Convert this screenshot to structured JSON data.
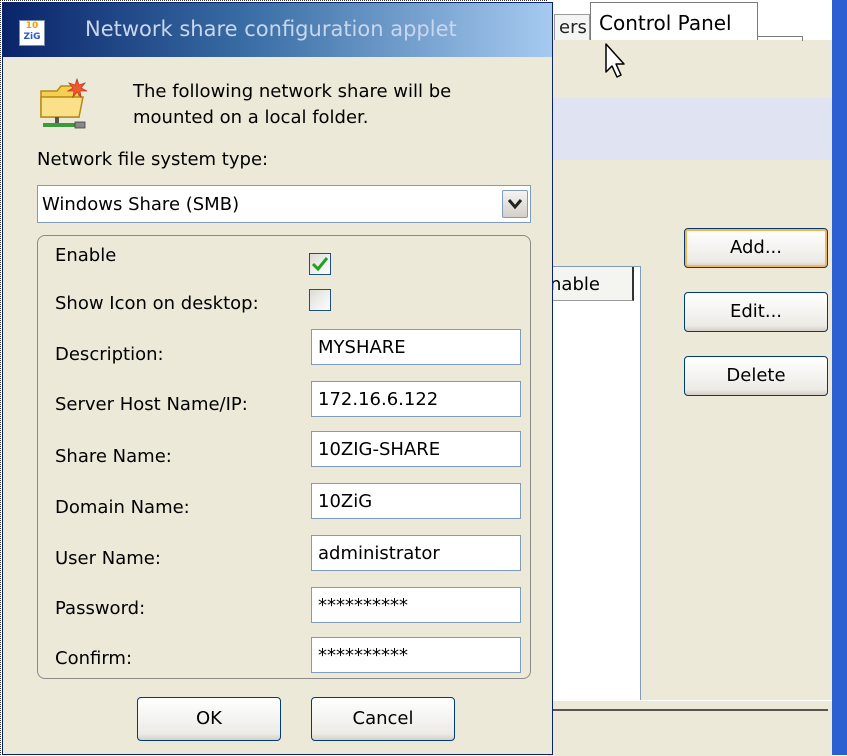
{
  "background_window": {
    "tabs": [
      {
        "label": "ers"
      },
      {
        "label": "Control Panel"
      }
    ],
    "list_column_header": "nable",
    "buttons": {
      "add": "Add...",
      "edit": "Edit...",
      "delete": "Delete"
    }
  },
  "dialog": {
    "title": "Network share configuration applet",
    "title_icon_text_top": "10",
    "title_icon_text_bottom": "ZiG",
    "header_message": "The following network share will be mounted on a local folder.",
    "fs_type_label": "Network file system type:",
    "fs_type_value": "Windows Share (SMB)",
    "fields": {
      "enable": {
        "label": "Enable",
        "checked": true
      },
      "show_icon": {
        "label": "Show Icon on desktop:",
        "checked": false
      },
      "description": {
        "label": "Description:",
        "value": "MYSHARE"
      },
      "server": {
        "label": "Server Host Name/IP:",
        "value": "172.16.6.122"
      },
      "share_name": {
        "label": "Share Name:",
        "value": "10ZIG-SHARE"
      },
      "domain": {
        "label": "Domain Name:",
        "value": "10ZiG"
      },
      "user": {
        "label": "User Name:",
        "value": "administrator"
      },
      "password": {
        "label": "Password:",
        "value": "**********"
      },
      "confirm": {
        "label": "Confirm:",
        "value": "**********"
      }
    },
    "buttons": {
      "ok": "OK",
      "cancel": "Cancel"
    }
  },
  "colors": {
    "title_gradient_start": "#0a246a",
    "title_gradient_end": "#a6caf0",
    "dialog_face": "#ece9d8",
    "checkmark_green": "#21a121",
    "window_edge_blue": "#2c5fd1"
  },
  "icons": [
    "folder-network-icon",
    "checkmark-icon",
    "dropdown-arrow-icon",
    "mouse-cursor-icon",
    "app-logo-icon"
  ]
}
